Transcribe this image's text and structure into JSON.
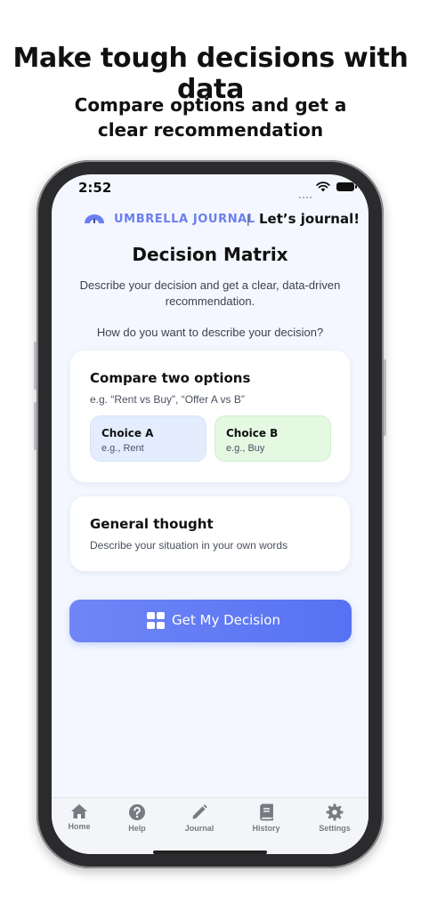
{
  "promo": {
    "headline": "Make tough decisions with data",
    "subheadline": "Compare options and get a clear recommendation"
  },
  "status_bar": {
    "time": "2:52",
    "icons": [
      "cellular-signal-icon",
      "wifi-icon",
      "battery-icon"
    ]
  },
  "brand": {
    "name": "UMBRELLA JOURNAL",
    "separator": "|",
    "tagline": "Let’s journal!",
    "logo_icon": "umbrella-logo-icon",
    "color": "#6b7ff0"
  },
  "page": {
    "title": "Decision Matrix",
    "description": "Describe your decision and get a clear, data-driven recommendation.",
    "question": "How do you want to describe your decision?"
  },
  "compare_card": {
    "title": "Compare two options",
    "subtitle": "e.g. “Rent vs Buy”, “Offer A vs B”",
    "choice_a": {
      "label": "Choice A",
      "placeholder": "e.g., Rent",
      "color": "#e3edfd"
    },
    "choice_b": {
      "label": "Choice B",
      "placeholder": "e.g., Buy",
      "color": "#e4f8e2"
    }
  },
  "general_card": {
    "title": "General thought",
    "subtitle": "Describe your situation in your own words"
  },
  "cta": {
    "label": "Get My Decision",
    "icon": "grid-icon",
    "color": "#5f7af5"
  },
  "tab_bar": {
    "items": [
      {
        "label": "Home",
        "icon": "home-icon"
      },
      {
        "label": "Help",
        "icon": "help-icon"
      },
      {
        "label": "Journal",
        "icon": "pencil-icon"
      },
      {
        "label": "History",
        "icon": "book-icon"
      },
      {
        "label": "Settings",
        "icon": "gear-icon"
      }
    ]
  }
}
